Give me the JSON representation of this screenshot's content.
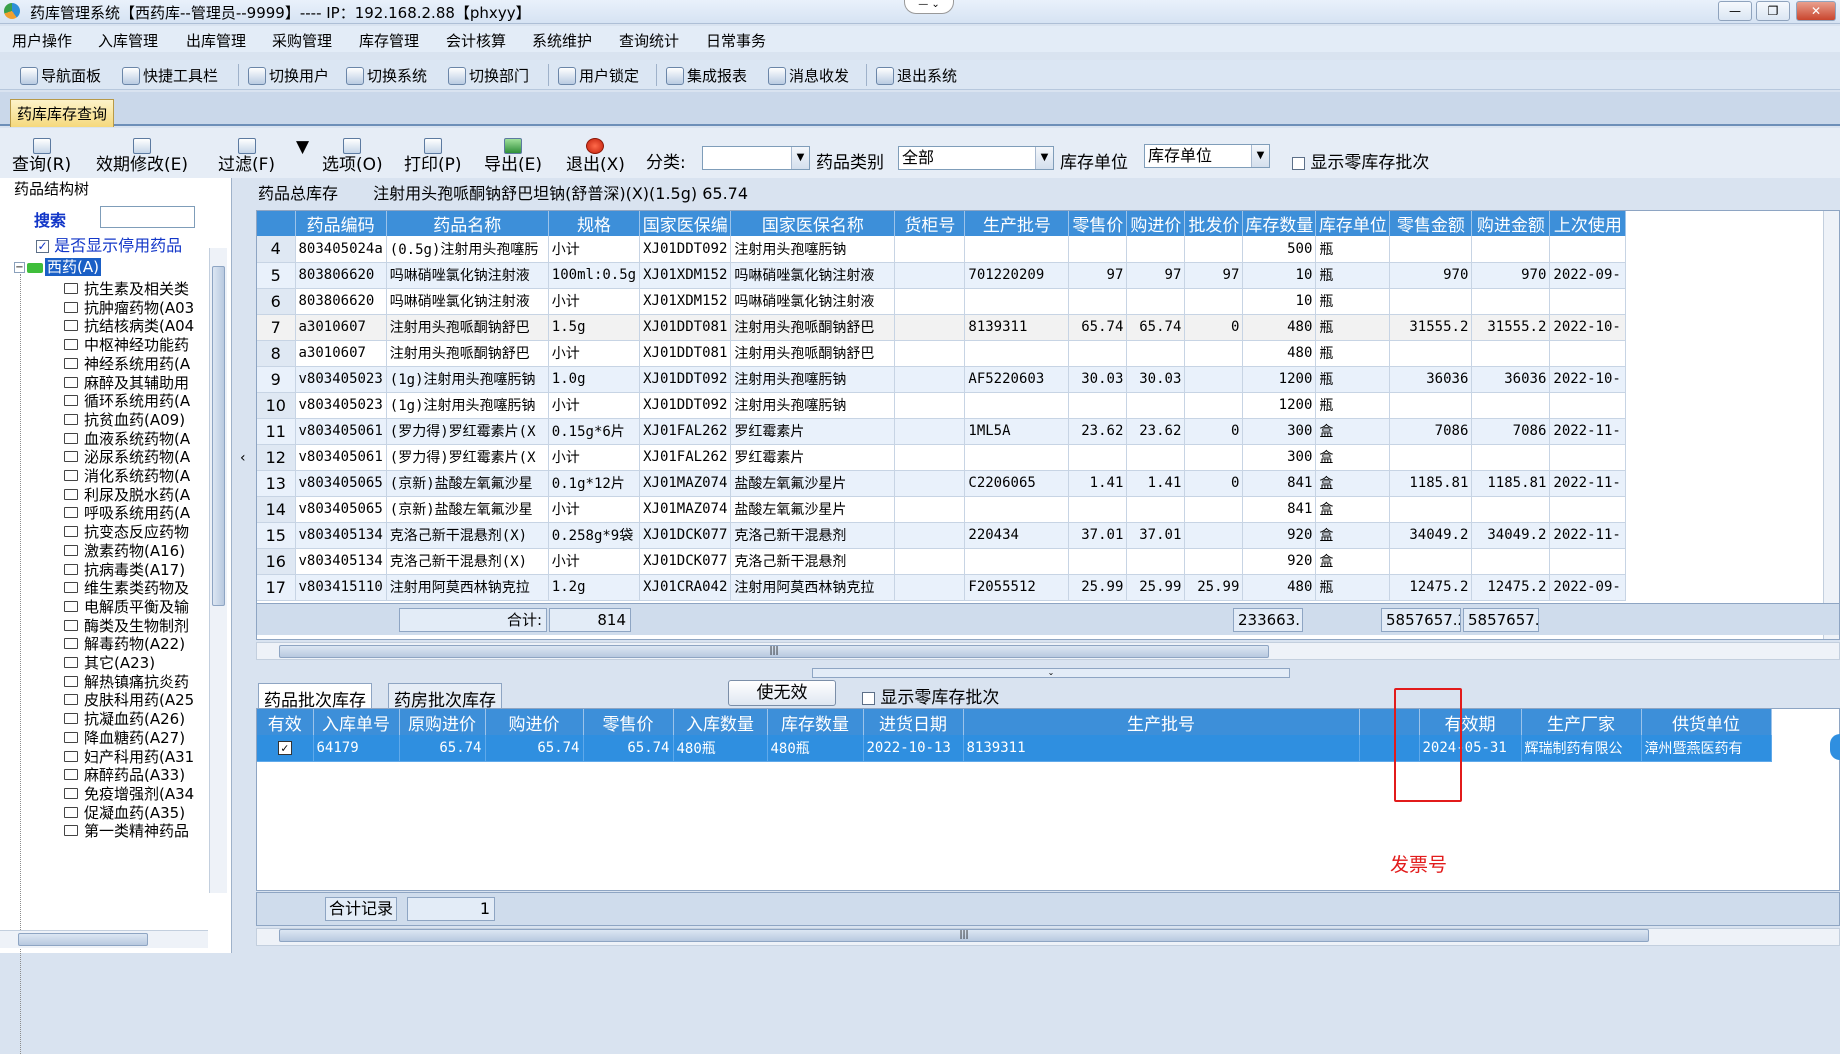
{
  "window": {
    "title": "药库管理系统【西药库--管理员--9999】---- IP：192.168.2.88【phxyy】"
  },
  "menu": [
    "用户操作",
    "入库管理",
    "出库管理",
    "采购管理",
    "库存管理",
    "会计核算",
    "系统维护",
    "查询统计",
    "日常事务"
  ],
  "toolbar": [
    {
      "label": "导航面板",
      "icon": "navigation-panel-icon"
    },
    {
      "label": "快捷工具栏",
      "icon": "shortcut-toolbar-icon"
    },
    {
      "label": "切换用户",
      "icon": "switch-user-icon"
    },
    {
      "label": "切换系统",
      "icon": "switch-system-icon"
    },
    {
      "label": "切换部门",
      "icon": "switch-department-icon"
    },
    {
      "label": "用户锁定",
      "icon": "lock-icon"
    },
    {
      "label": "集成报表",
      "icon": "report-icon"
    },
    {
      "label": "消息收发",
      "icon": "message-icon"
    },
    {
      "label": "退出系统",
      "icon": "exit-icon"
    }
  ],
  "main_tab": "药库库存查询",
  "query_bar": {
    "buttons": [
      "查询(R)",
      "效期修改(E)",
      "过滤(F)",
      "选项(O)",
      "打印(P)",
      "导出(E)",
      "退出(X)"
    ],
    "category_label": "分类:",
    "category_value": "",
    "drug_type_label": "药品类别",
    "drug_type_value": "全部",
    "stock_unit_label": "库存单位",
    "stock_unit_value": "库存单位",
    "show_zero_label": "显示零库存批次"
  },
  "left_panel": {
    "header": "药品结构树",
    "search_label": "搜索",
    "search_value": "",
    "show_disabled_label": "是否显示停用药品",
    "show_disabled_checked": true,
    "root": "西药(A)",
    "items": [
      "抗生素及相关类",
      "抗肿瘤药物(A03",
      "抗结核病类(A04",
      "中枢神经功能药",
      "神经系统用药(A",
      "麻醉及其辅助用",
      "循环系统用药(A",
      "抗贫血药(A09)",
      "血液系统药物(A",
      "泌尿系统药物(A",
      "消化系统药物(A",
      "利尿及脱水药(A",
      "呼吸系统用药(A",
      "抗变态反应药物",
      "激素药物(A16)",
      "抗病毒类(A17)",
      "维生素类药物及",
      "电解质平衡及输",
      "酶类及生物制剂",
      "解毒药物(A22)",
      "其它(A23)",
      "解热镇痛抗炎药",
      "皮肤科用药(A25",
      "抗凝血药(A26)",
      "降血糖药(A27)",
      "妇产科用药(A31",
      "麻醉药品(A33)",
      "免疫增强剂(A34",
      "促凝血药(A35)",
      "第一类精神药品"
    ]
  },
  "upper_info": {
    "label": "药品总库存",
    "selected_drug": "注射用头孢哌酮钠舒巴坦钠(舒普深)(X)(1.5g)  65.74"
  },
  "upper_grid": {
    "columns": [
      "",
      "药品编码",
      "药品名称",
      "规格",
      "国家医保编",
      "国家医保名称",
      "货柜号",
      "生产批号",
      "零售价",
      "购进价",
      "批发价",
      "库存数量",
      "库存单位",
      "零售金额",
      "购进金额",
      "上次使用"
    ],
    "rows": [
      [
        "4",
        "803405024a",
        "(0.5g)注射用头孢噻肟",
        "小计",
        "XJ01DDT092",
        "注射用头孢噻肟钠",
        "",
        "",
        "",
        "",
        "",
        "500",
        "瓶",
        "",
        "",
        ""
      ],
      [
        "5",
        "803806620",
        "吗啉硝唑氯化钠注射液",
        "100ml:0.5g",
        "XJ01XDM152",
        "吗啉硝唑氯化钠注射液",
        "",
        "701220209",
        "97",
        "97",
        "97",
        "10",
        "瓶",
        "970",
        "970",
        "2022-09-"
      ],
      [
        "6",
        "803806620",
        "吗啉硝唑氯化钠注射液",
        "小计",
        "XJ01XDM152",
        "吗啉硝唑氯化钠注射液",
        "",
        "",
        "",
        "",
        "",
        "10",
        "瓶",
        "",
        "",
        ""
      ],
      [
        "7",
        "a3010607",
        "注射用头孢哌酮钠舒巴",
        "1.5g",
        "XJ01DDT081",
        "注射用头孢哌酮钠舒巴",
        "",
        "8139311",
        "65.74",
        "65.74",
        "0",
        "480",
        "瓶",
        "31555.2",
        "31555.2",
        "2022-10-"
      ],
      [
        "8",
        "a3010607",
        "注射用头孢哌酮钠舒巴",
        "小计",
        "XJ01DDT081",
        "注射用头孢哌酮钠舒巴",
        "",
        "",
        "",
        "",
        "",
        "480",
        "瓶",
        "",
        "",
        ""
      ],
      [
        "9",
        "v803405023",
        "(1g)注射用头孢噻肟钠",
        "1.0g",
        "XJ01DDT092",
        "注射用头孢噻肟钠",
        "",
        "AF5220603",
        "30.03",
        "30.03",
        "",
        "1200",
        "瓶",
        "36036",
        "36036",
        "2022-10-"
      ],
      [
        "10",
        "v803405023",
        "(1g)注射用头孢噻肟钠",
        "小计",
        "XJ01DDT092",
        "注射用头孢噻肟钠",
        "",
        "",
        "",
        "",
        "",
        "1200",
        "瓶",
        "",
        "",
        ""
      ],
      [
        "11",
        "v803405061",
        "(罗力得)罗红霉素片(X",
        "0.15g*6片",
        "XJ01FAL262",
        "罗红霉素片",
        "",
        "1ML5A",
        "23.62",
        "23.62",
        "0",
        "300",
        "盒",
        "7086",
        "7086",
        "2022-11-"
      ],
      [
        "12",
        "v803405061",
        "(罗力得)罗红霉素片(X",
        "小计",
        "XJ01FAL262",
        "罗红霉素片",
        "",
        "",
        "",
        "",
        "",
        "300",
        "盒",
        "",
        "",
        ""
      ],
      [
        "13",
        "v803405065",
        "(京新)盐酸左氧氟沙星",
        "0.1g*12片",
        "XJ01MAZ074",
        "盐酸左氧氟沙星片",
        "",
        "C2206065",
        "1.41",
        "1.41",
        "0",
        "841",
        "盒",
        "1185.81",
        "1185.81",
        "2022-11-"
      ],
      [
        "14",
        "v803405065",
        "(京新)盐酸左氧氟沙星",
        "小计",
        "XJ01MAZ074",
        "盐酸左氧氟沙星片",
        "",
        "",
        "",
        "",
        "",
        "841",
        "盒",
        "",
        "",
        ""
      ],
      [
        "15",
        "v803405134",
        "克洛己新干混悬剂(X)",
        "0.258g*9袋",
        "XJ01DCK077",
        "克洛己新干混悬剂",
        "",
        "220434",
        "37.01",
        "37.01",
        "",
        "920",
        "盒",
        "34049.2",
        "34049.2",
        "2022-11-"
      ],
      [
        "16",
        "v803405134",
        "克洛己新干混悬剂(X)",
        "小计",
        "XJ01DCK077",
        "克洛己新干混悬剂",
        "",
        "",
        "",
        "",
        "",
        "920",
        "盒",
        "",
        "",
        ""
      ],
      [
        "17",
        "v803415110",
        "注射用阿莫西林钠克拉",
        "1.2g",
        "XJ01CRA042",
        "注射用阿莫西林钠克拉",
        "",
        "F2055512",
        "25.99",
        "25.99",
        "25.99",
        "480",
        "瓶",
        "12475.2",
        "12475.2",
        "2022-09-"
      ]
    ],
    "summary": {
      "label": "合计:",
      "count": "814",
      "stock_total": "233663.",
      "retail_total": "5857657.2",
      "purchase_total": "5857657."
    }
  },
  "lower_tabs": [
    "药品批次库存",
    "药房批次库存"
  ],
  "lower_actions": {
    "invalidate_button": "使无效",
    "show_zero_label": "显示零库存批次"
  },
  "lower_grid": {
    "columns": [
      "有效",
      "入库单号",
      "原购进价",
      "购进价",
      "零售价",
      "入库数量",
      "库存数量",
      "进货日期",
      "生产批号",
      "",
      "有效期",
      "生产厂家",
      "供货单位"
    ],
    "rows": [
      {
        "checked": true,
        "cells": [
          "64179",
          "65.74",
          "65.74",
          "65.74",
          "480瓶",
          "480瓶",
          "2022-10-13",
          "8139311",
          "",
          "2024-05-31",
          "辉瑞制药有限公",
          "漳州暨燕医药有"
        ]
      }
    ],
    "footer_label": "合计记录",
    "footer_count": "1"
  },
  "annotation": {
    "note": "发票号",
    "color": "#e21b1b"
  }
}
